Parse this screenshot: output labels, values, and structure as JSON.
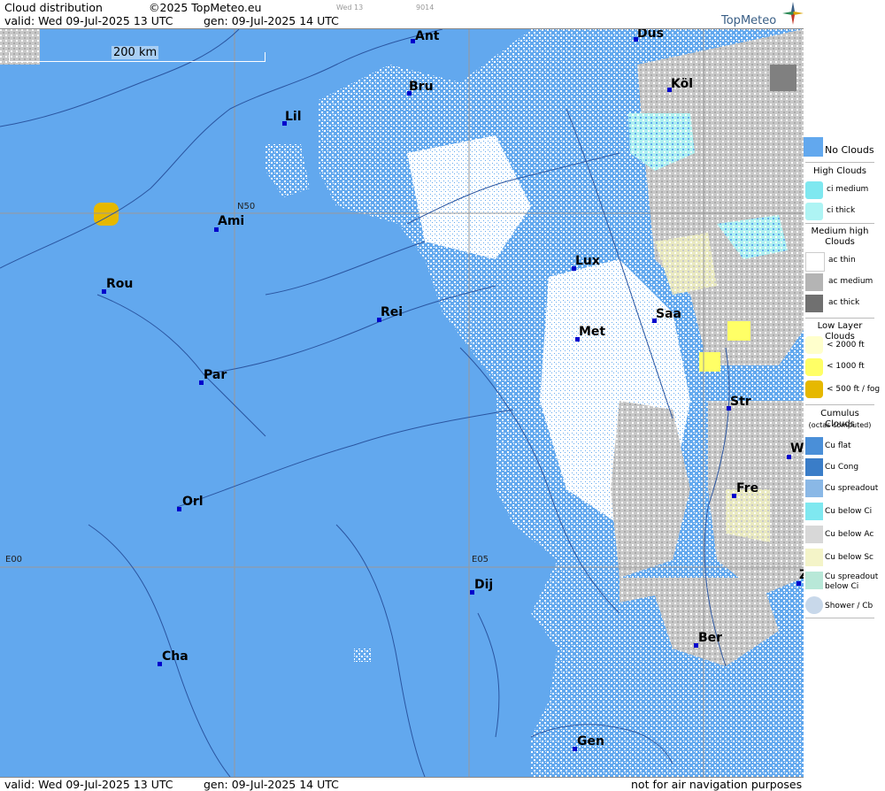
{
  "header": {
    "product": "Cloud distribution",
    "copyright": "©2025 TopMeteo.eu",
    "run_tag": "Wed 13",
    "code_tag": "9014",
    "valid": "valid:  Wed  09-Jul-2025  13 UTC",
    "generated": "gen: 09-Jul-2025 14 UTC",
    "brand": "TopMeteo"
  },
  "footer": {
    "valid": "valid:  Wed  09-Jul-2025  13 UTC",
    "generated": "gen: 09-Jul-2025 14 UTC",
    "disclaimer": "not for air navigation purposes"
  },
  "map": {
    "scale_label": "200 km",
    "grid_labels": {
      "lat_n50": "N50",
      "lon_e00": "E00",
      "lon_e05": "E05"
    },
    "cities": [
      {
        "name": "Ant"
      },
      {
        "name": "Düs"
      },
      {
        "name": "Bru"
      },
      {
        "name": "Köl"
      },
      {
        "name": "Lil"
      },
      {
        "name": "Ami"
      },
      {
        "name": "Lux"
      },
      {
        "name": "Rou"
      },
      {
        "name": "Rei"
      },
      {
        "name": "Saa"
      },
      {
        "name": "Met"
      },
      {
        "name": "Par"
      },
      {
        "name": "Str"
      },
      {
        "name": "W"
      },
      {
        "name": "Fre"
      },
      {
        "name": "Orl"
      },
      {
        "name": "Dij"
      },
      {
        "name": "Z"
      },
      {
        "name": "Ber"
      },
      {
        "name": "Cha"
      },
      {
        "name": "Gen"
      }
    ],
    "colors": {
      "no_clouds": "#62a8ee",
      "land_line": "#2a55a0",
      "grid": "#999999"
    }
  },
  "legend": {
    "no_clouds": "No Clouds",
    "high_clouds": "High Clouds",
    "ci_medium": "ci medium",
    "ci_thick": "ci thick",
    "medium_high": "Medium high Clouds",
    "ac_thin": "ac thin",
    "ac_medium": "ac medium",
    "ac_thick": "ac thick",
    "low_layer": "Low Layer Clouds",
    "lt2000": "< 2000 ft",
    "lt1000": "< 1000 ft",
    "lt500": "< 500 ft / fog",
    "cumulus": "Cumulus Clouds",
    "cumulus_sub": "(octas computed)",
    "cu_flat": "Cu flat",
    "cu_cong": "Cu Cong",
    "cu_spreadout": "Cu spreadout",
    "cu_below_ci": "Cu below Ci",
    "cu_below_ac": "Cu below Ac",
    "cu_below_sc": "Cu below Sc",
    "cu_spread_below_ci": "Cu spreadout below Ci",
    "shower_cb": "Shower / Cb"
  }
}
